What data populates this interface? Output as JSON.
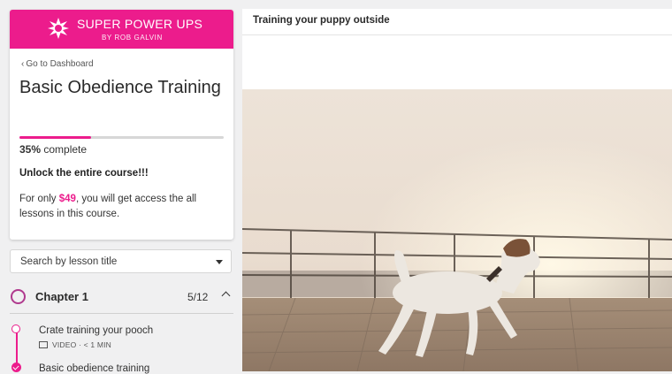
{
  "brand": {
    "name": "SUPER POWER UPS",
    "byline": "BY ROB GALVIN"
  },
  "nav": {
    "back_label": "Go to Dashboard"
  },
  "course": {
    "title": "Basic Obedience Training",
    "progress_fraction": 0.35,
    "progress_percent": "35%",
    "progress_suffix": " complete",
    "unlock_heading": "Unlock the entire course!!!",
    "offer_prefix": "For only ",
    "offer_price": "$49",
    "offer_suffix": ", you will get access the all lessons in this course."
  },
  "search": {
    "placeholder": "Search by lesson title"
  },
  "chapter": {
    "label": "Chapter 1",
    "count": "5/12"
  },
  "lessons": [
    {
      "title": "Crate training your pooch",
      "meta": "VIDEO · < 1 MIN"
    },
    {
      "title": "Basic obedience training"
    }
  ],
  "content": {
    "title": "Training your puppy outside"
  },
  "colors": {
    "accent": "#ec1c8c"
  },
  "icons": {
    "logo": "star-burst-icon",
    "back": "chevron-left-icon",
    "select": "caret-down-icon",
    "collapse": "chevron-up-icon",
    "video": "video-icon",
    "done": "check-circle-icon"
  }
}
